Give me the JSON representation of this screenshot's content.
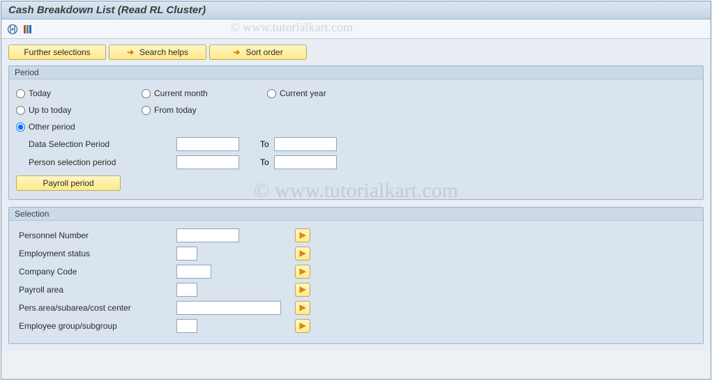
{
  "title": "Cash Breakdown List (Read RL Cluster)",
  "watermark": "© www.tutorialkart.com",
  "topButtons": {
    "further": "Further selections",
    "searchHelps": "Search helps",
    "sortOrder": "Sort order"
  },
  "period": {
    "legend": "Period",
    "today": "Today",
    "currentMonth": "Current month",
    "currentYear": "Current year",
    "upToToday": "Up to today",
    "fromToday": "From today",
    "otherPeriod": "Other period",
    "dataSelLabel": "Data Selection Period",
    "personSelLabel": "Person selection period",
    "to": "To",
    "dataSelFrom": "",
    "dataSelTo": "",
    "personSelFrom": "",
    "personSelTo": "",
    "payrollPeriodBtn": "Payroll period"
  },
  "selection": {
    "legend": "Selection",
    "rows": [
      {
        "label": "Personnel Number",
        "inputClass": "w80",
        "value": ""
      },
      {
        "label": "Employment status",
        "inputClass": "w30",
        "value": ""
      },
      {
        "label": "Company Code",
        "inputClass": "w50",
        "value": ""
      },
      {
        "label": "Payroll area",
        "inputClass": "w30",
        "value": ""
      },
      {
        "label": "Pers.area/subarea/cost center",
        "inputClass": "w150",
        "value": ""
      },
      {
        "label": "Employee group/subgroup",
        "inputClass": "w30",
        "value": ""
      }
    ]
  }
}
